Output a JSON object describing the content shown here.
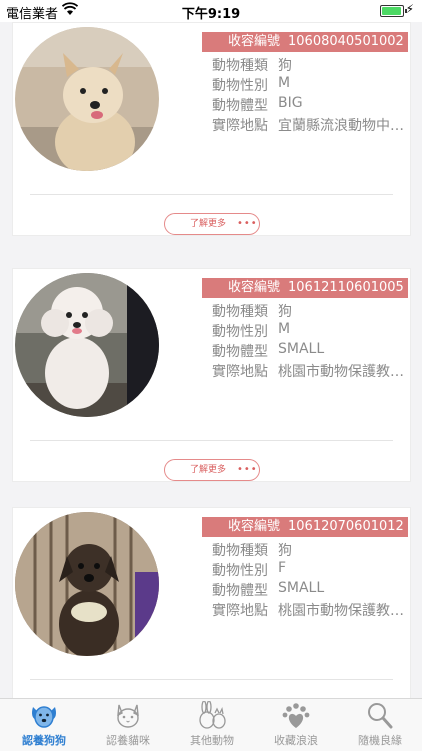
{
  "status_bar": {
    "carrier": "電信業者",
    "time": "下午9:19"
  },
  "labels": {
    "id": "收容編號",
    "species": "動物種類",
    "sex": "動物性別",
    "size": "動物體型",
    "place": "實際地點"
  },
  "more_label": "了解更多",
  "more_dots": "•••",
  "cards": [
    {
      "id": "10608040501002",
      "species": "狗",
      "sex": "M",
      "size": "BIG",
      "place": "宜蘭縣流浪動物中…"
    },
    {
      "id": "10612110601005",
      "species": "狗",
      "sex": "M",
      "size": "SMALL",
      "place": "桃園市動物保護教…"
    },
    {
      "id": "10612070601012",
      "species": "狗",
      "sex": "F",
      "size": "SMALL",
      "place": "桃園市動物保護教…"
    }
  ],
  "tabs": [
    {
      "label": "認養狗狗",
      "icon": "dog-icon"
    },
    {
      "label": "認養貓咪",
      "icon": "cat-icon"
    },
    {
      "label": "其他動物",
      "icon": "rabbit-icon"
    },
    {
      "label": "收藏浪浪",
      "icon": "paw-heart-icon"
    },
    {
      "label": "隨機良緣",
      "icon": "magnifier-icon"
    }
  ],
  "colors": {
    "accent": "#d97b7b",
    "tab_active": "#2f7fd1"
  }
}
